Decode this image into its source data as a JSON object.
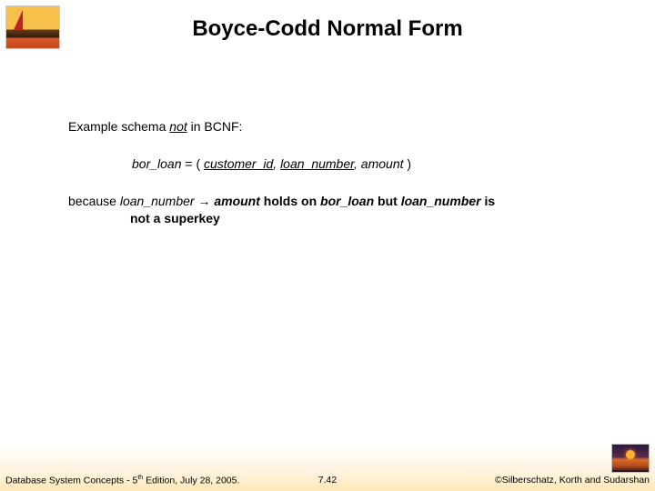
{
  "title": "Boyce-Codd Normal Form",
  "line1_pre": "Example schema ",
  "line1_not": "not",
  "line1_post": " in BCNF:",
  "schema_rel": "bor_loan",
  "schema_eq": " = ( ",
  "schema_k1": "customer_id",
  "schema_sep1": ", ",
  "schema_k2": "loan_number",
  "schema_sep2": ", ",
  "schema_a3": "amount",
  "schema_close": " )",
  "because_w": "because ",
  "because_fd_l": "loan_number",
  "because_arrow": " → ",
  "because_fd_r": "amount",
  "because_mid1": " holds on ",
  "because_rel": "bor_loan",
  "because_mid2": " but ",
  "because_ln2": "loan_number",
  "because_mid3": " is",
  "because_hang": "not a superkey",
  "footer_left_a": "Database System Concepts - 5",
  "footer_left_sup": "th",
  "footer_left_b": " Edition, July 28,  2005.",
  "footer_center": "7.42",
  "footer_right": "©Silberschatz, Korth and Sudarshan"
}
